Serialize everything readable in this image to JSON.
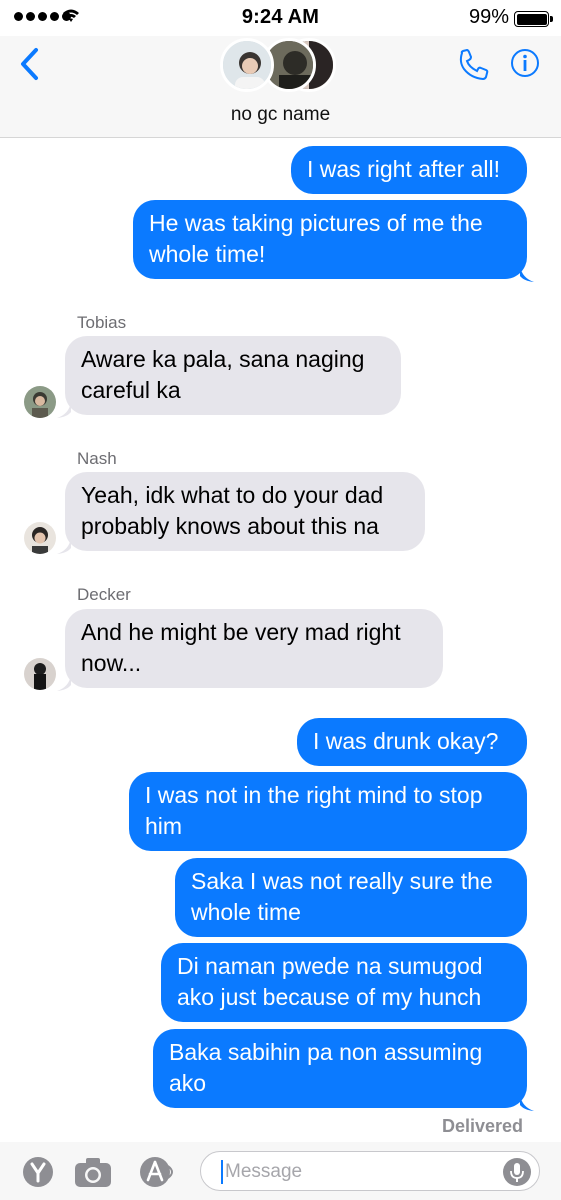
{
  "status_bar": {
    "time": "9:24 AM",
    "battery": "99%"
  },
  "header": {
    "chat_name": "no gc name"
  },
  "messages": [
    {
      "text": "I was right after all!"
    },
    {
      "text": "He was taking pictures of me the whole time!"
    },
    {
      "sender": "Tobias",
      "text": "Aware ka pala, sana naging careful ka"
    },
    {
      "sender": "Nash",
      "text": "Yeah, idk what to do your dad probably knows about this na"
    },
    {
      "sender": "Decker",
      "text": "And he might be very mad right now..."
    },
    {
      "text": "I was drunk okay?"
    },
    {
      "text": "I was not in the right mind to stop him"
    },
    {
      "text": "Saka I was not really sure the whole time"
    },
    {
      "text": "Di naman pwede na sumugod ako just because of my hunch"
    },
    {
      "text": "Baka sabihin pa non assuming ako"
    }
  ],
  "delivered": "Delivered",
  "input": {
    "placeholder": "Message"
  },
  "colors": {
    "outgoing": "#0b7aff",
    "incoming": "#e6e5eb",
    "accent": "#0b7aff"
  },
  "icons": [
    "back-chevron-icon",
    "phone-icon",
    "info-icon",
    "appstore-y-icon",
    "camera-icon",
    "apps-icon",
    "mic-icon"
  ]
}
